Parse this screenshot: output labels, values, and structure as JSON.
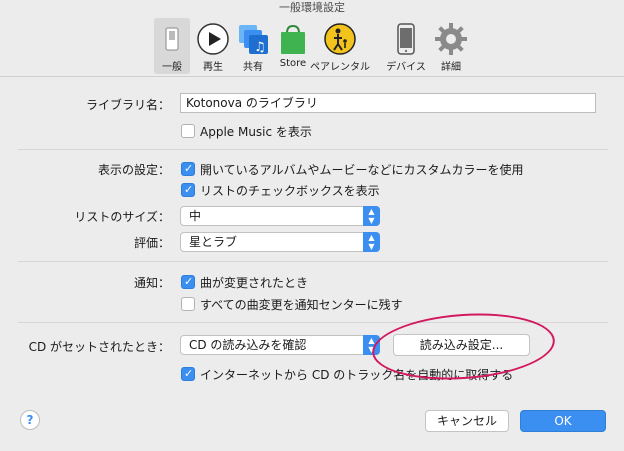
{
  "window": {
    "title": "一般環境設定"
  },
  "toolbar": {
    "items": [
      {
        "label": "一般",
        "icon": "switch-icon"
      },
      {
        "label": "再生",
        "icon": "play-icon"
      },
      {
        "label": "共有",
        "icon": "music-library-icon"
      },
      {
        "label": "Store",
        "icon": "shopping-bag-icon"
      },
      {
        "label": "ペアレンタル",
        "icon": "parental-icon"
      },
      {
        "label": "デバイス",
        "icon": "phone-icon"
      },
      {
        "label": "詳細",
        "icon": "gear-icon"
      }
    ]
  },
  "library": {
    "label": "ライブラリ名：",
    "value": "Kotonova のライブラリ",
    "apple_music": {
      "label": "Apple Music を表示",
      "checked": false
    }
  },
  "display": {
    "label": "表示の設定：",
    "options": [
      {
        "label": "開いているアルバムやムービーなどにカスタムカラーを使用",
        "checked": true
      },
      {
        "label": "リストのチェックボックスを表示",
        "checked": true
      }
    ]
  },
  "list_size": {
    "label": "リストのサイズ：",
    "value": "中"
  },
  "rating": {
    "label": "評価：",
    "value": "星とラブ"
  },
  "notify": {
    "label": "通知：",
    "options": [
      {
        "label": "曲が変更されたとき",
        "checked": true
      },
      {
        "label": "すべての曲変更を通知センターに残す",
        "checked": false
      }
    ]
  },
  "cd": {
    "label": "CD がセットされたとき：",
    "value": "CD の読み込みを確認",
    "import_button": "読み込み設定...",
    "retrieve": {
      "label": "インターネットから CD のトラック名を自動的に取得する",
      "checked": true
    }
  },
  "footer": {
    "help": "?",
    "cancel": "キャンセル",
    "ok": "OK"
  },
  "colors": {
    "accent": "#3b8ff0",
    "annotation": "#d2185e"
  }
}
